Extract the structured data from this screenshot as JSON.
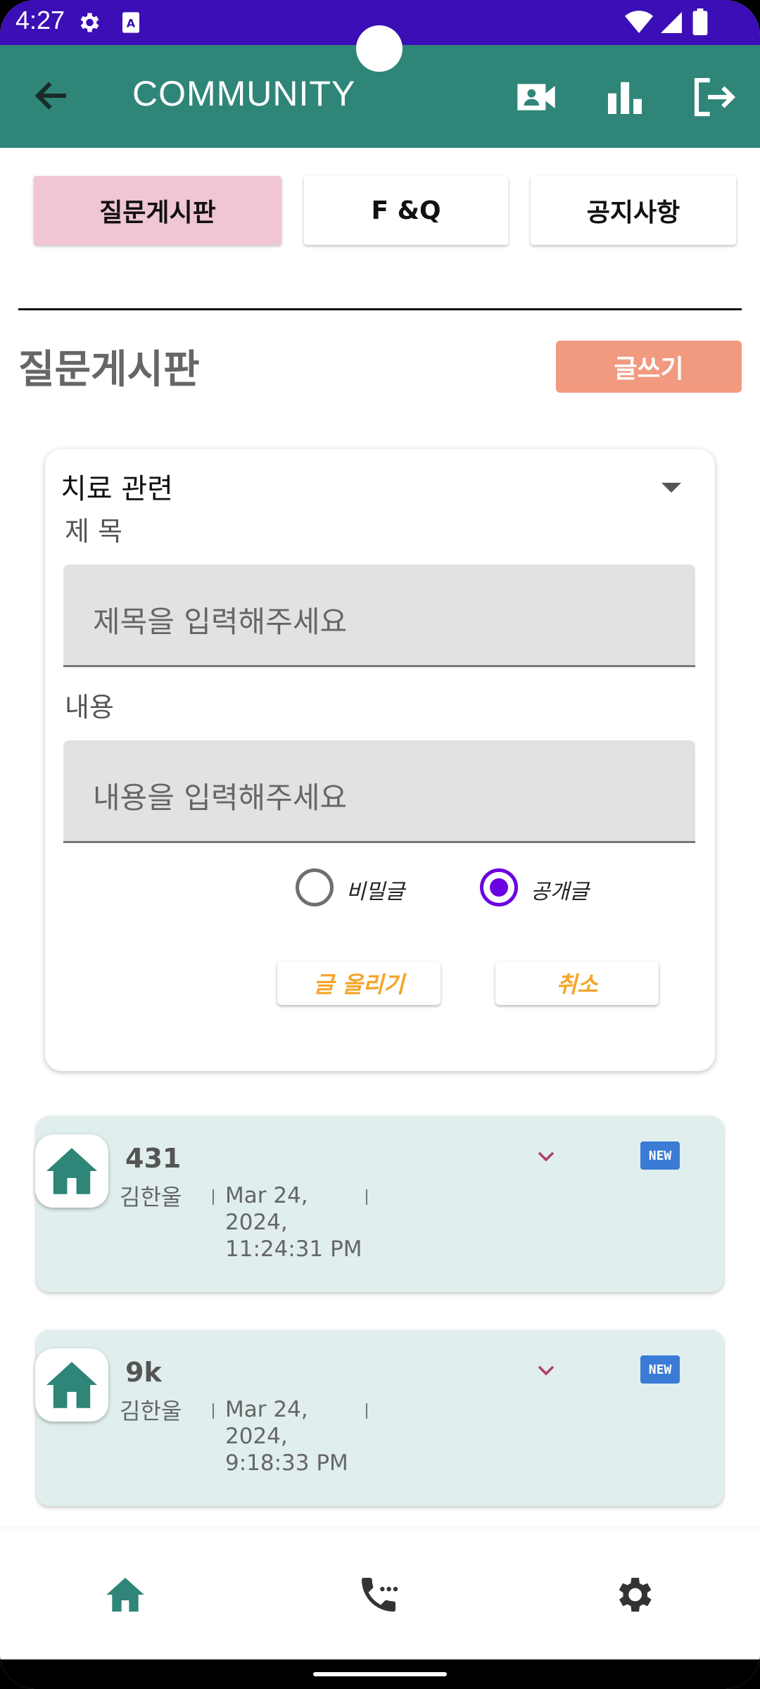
{
  "status_bar": {
    "time": "4:27"
  },
  "app_bar": {
    "title": "COMMUNITY"
  },
  "tabs": [
    {
      "label": "질문게시판",
      "active": true
    },
    {
      "label": "F &Q",
      "active": false
    },
    {
      "label": "공지사항",
      "active": false
    }
  ],
  "section": {
    "title": "질문게시판",
    "write_button": "글쓰기"
  },
  "form": {
    "category": "치료 관련",
    "title_label": "제 목",
    "title_placeholder": "제목을 입력해주세요",
    "content_label": "내용",
    "content_placeholder": "내용을 입력해주세요",
    "radio_private": "비밀글",
    "radio_public": "공개글",
    "selected_visibility": "공개글",
    "submit_label": "글 올리기",
    "cancel_label": "취소"
  },
  "posts": [
    {
      "title": "431",
      "author": "김한울",
      "date": "Mar 24,\n2024,\n11:24:31 PM",
      "badge": "NEW"
    },
    {
      "title": "9k",
      "author": "김한울",
      "date": "Mar 24,\n2024,\n9:18:33 PM",
      "badge": "NEW"
    }
  ],
  "colors": {
    "status_bar": "#3b0fb5",
    "app_bar": "#2e8578",
    "active_tab": "#f0c5d4",
    "write_button": "#f19a80",
    "post_bg": "#e0efee",
    "accent_orange": "#f4a52a",
    "radio_checked": "#6b00e0"
  },
  "bottom_nav": {
    "icons": [
      "home-icon",
      "phone-icon",
      "settings-icon"
    ]
  }
}
